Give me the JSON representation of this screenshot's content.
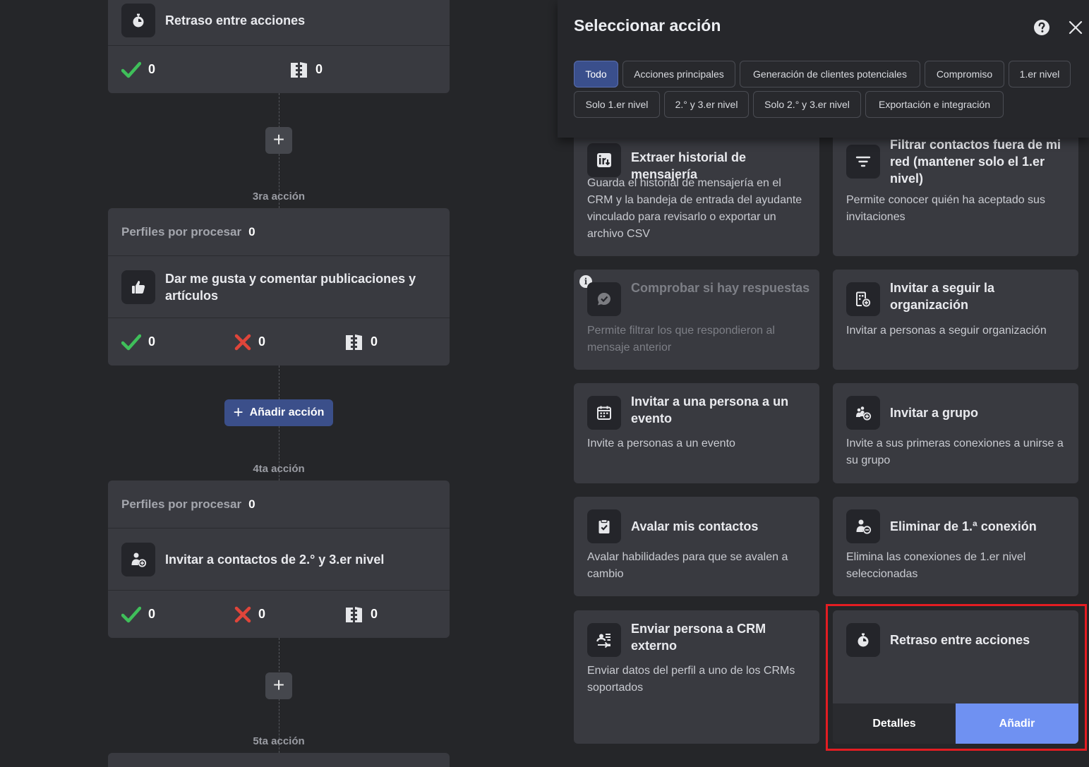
{
  "flow": {
    "card1": {
      "title": "Retraso entre acciones",
      "stats": {
        "success": "0",
        "skipped": "0"
      }
    },
    "step3_label": "3ra acción",
    "card3": {
      "pending_label": "Perfiles por procesar",
      "pending_count": "0",
      "title": "Dar me gusta y comentar publicaciones y artículos",
      "stats": {
        "success": "0",
        "failed": "0",
        "skipped": "0"
      }
    },
    "add_action_label": "Añadir acción",
    "step4_label": "4ta acción",
    "card4": {
      "pending_label": "Perfiles por procesar",
      "pending_count": "0",
      "title": "Invitar a contactos de 2.° y 3.er nivel",
      "stats": {
        "success": "0",
        "failed": "0",
        "skipped": "0"
      }
    },
    "plus_label": "+",
    "step5_label": "5ta acción"
  },
  "panel": {
    "title": "Seleccionar acción",
    "filters": [
      "Todo",
      "Acciones principales",
      "Generación de clientes potenciales",
      "Compromiso",
      "1.er nivel",
      "Solo 1.er nivel",
      "2.° y 3.er nivel",
      "Solo 2.° y 3.er nivel",
      "Exportación e integración"
    ],
    "active_filter": "Todo",
    "actions": [
      {
        "title": "Extraer historial de mensajería",
        "desc": "Guarda el historial de mensajería en el CRM y la bandeja de entrada del ayudante vinculado para revisarlo o exportar un archivo CSV",
        "icon": "linkedin-export-icon"
      },
      {
        "title": "Filtrar contactos fuera de mi red (mantener solo el 1.er nivel)",
        "desc": "Permite conocer quién ha aceptado sus invitaciones",
        "icon": "filter-icon"
      },
      {
        "title": "Comprobar si hay respuestas",
        "desc": "Permite filtrar los que respondieron al mensaje anterior",
        "icon": "chat-check-icon",
        "disabled": true,
        "info": "i"
      },
      {
        "title": "Invitar a seguir la organización",
        "desc": "Invitar a personas a seguir organización",
        "icon": "building-plus-icon"
      },
      {
        "title": "Invitar a una persona a un evento",
        "desc": "Invite a personas a un evento",
        "icon": "calendar-icon"
      },
      {
        "title": "Invitar a grupo",
        "desc": "Invite a sus primeras conexiones a unirse a su grupo",
        "icon": "group-plus-icon"
      },
      {
        "title": "Avalar mis contactos",
        "desc": "Avalar habilidades para que se avalen a cambio",
        "icon": "clipboard-check-icon"
      },
      {
        "title": "Eliminar de 1.ª conexión",
        "desc": "Elimina las conexiones de 1.er nivel seleccionadas",
        "icon": "user-minus-icon"
      },
      {
        "title": "Enviar persona a CRM externo",
        "desc": "Enviar datos del perfil a uno de los CRMs soportados",
        "icon": "contact-send-icon"
      },
      {
        "title": "Retraso entre acciones",
        "desc": "",
        "icon": "stopwatch-icon",
        "selected": true
      }
    ],
    "selected_buttons": {
      "details": "Detalles",
      "add": "Añadir"
    }
  },
  "colors": {
    "background": "#252629",
    "card": "#393a40",
    "accent_blue": "#6f91f2",
    "chip_active": "#3a4f8c",
    "success_green": "#3fbf5a",
    "failed_red": "#e0453a",
    "highlight_red": "#e31d22"
  }
}
